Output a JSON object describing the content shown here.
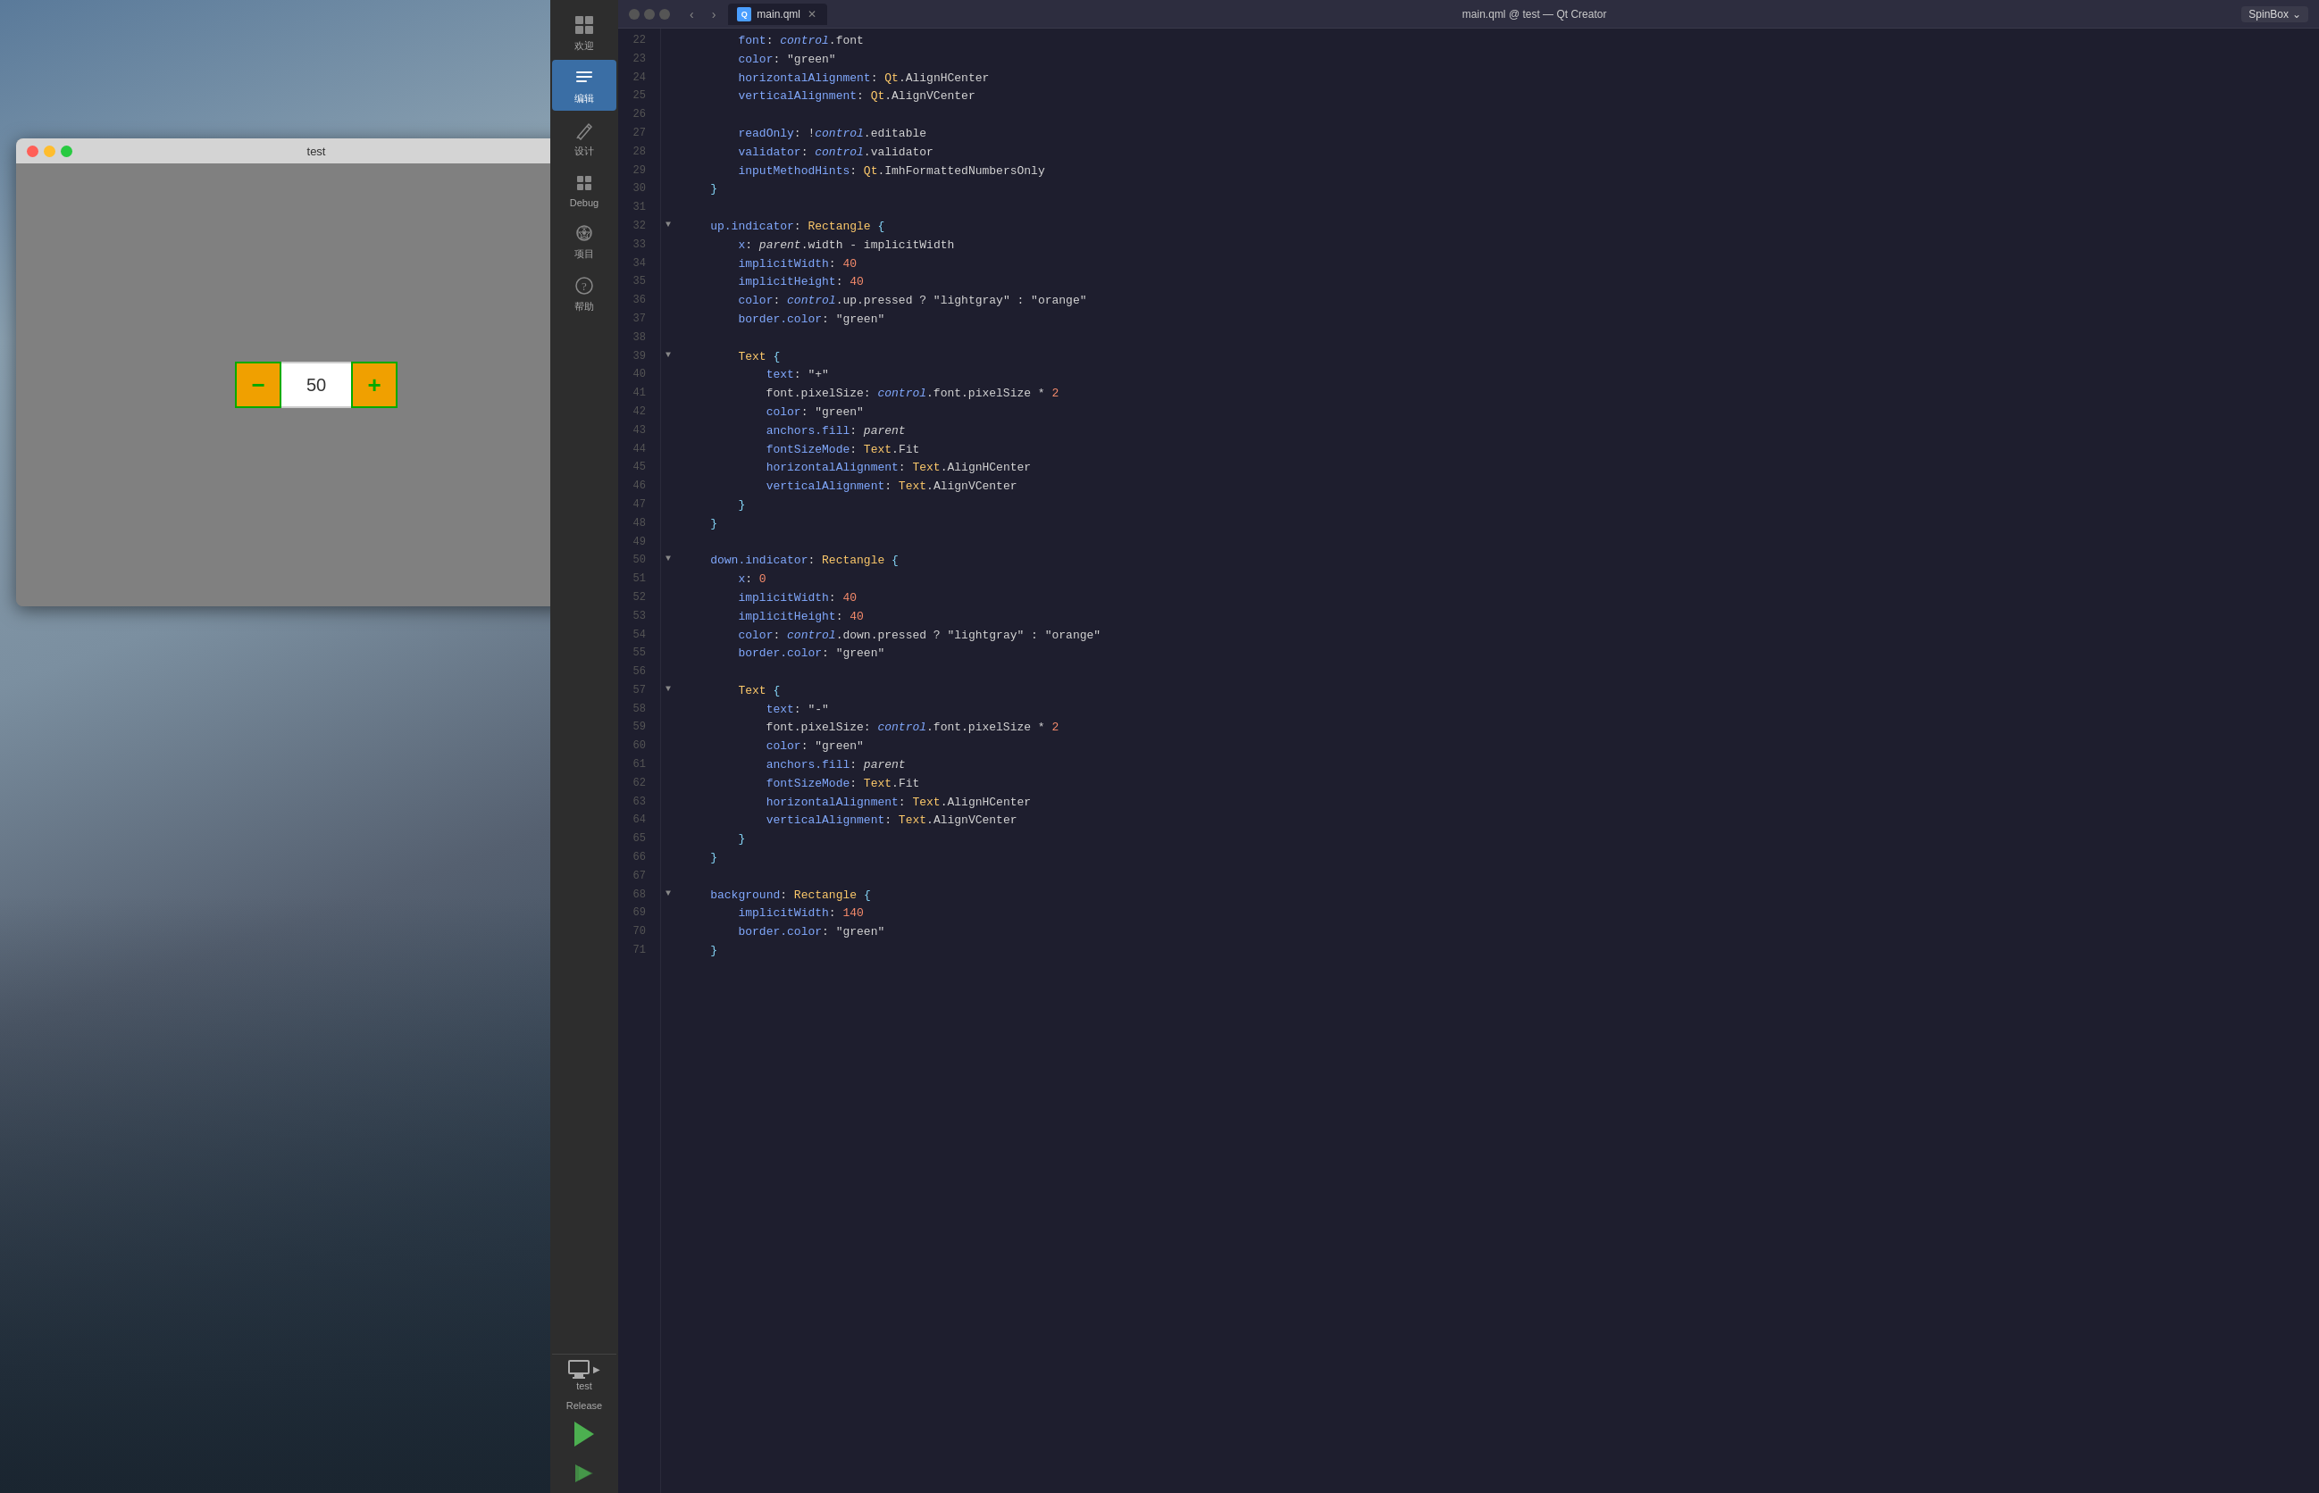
{
  "window": {
    "title": "main.qml @ test — Qt Creator"
  },
  "test_window": {
    "title": "test",
    "spinbox_value": "50"
  },
  "toolbar": {
    "items": [
      {
        "id": "welcome",
        "label": "欢迎",
        "icon": "⊞"
      },
      {
        "id": "edit",
        "label": "编辑",
        "icon": "≡",
        "active": true
      },
      {
        "id": "design",
        "label": "设计",
        "icon": "✏"
      },
      {
        "id": "debug",
        "label": "Debug",
        "icon": "🔲"
      },
      {
        "id": "project",
        "label": "项目",
        "icon": "🔧"
      },
      {
        "id": "help",
        "label": "帮助",
        "icon": "?"
      }
    ],
    "run": {
      "kit_label": "test",
      "build_label": "Release",
      "run_label": "▶",
      "debug_label": "▶"
    }
  },
  "editor": {
    "filename": "main.qml",
    "context": "test",
    "component": "SpinBox",
    "lines": [
      {
        "num": 22,
        "content": "        font: control.font"
      },
      {
        "num": 23,
        "content": "        color: \"green\""
      },
      {
        "num": 24,
        "content": "        horizontalAlignment: Qt.AlignHCenter"
      },
      {
        "num": 25,
        "content": "        verticalAlignment: Qt.AlignVCenter"
      },
      {
        "num": 26,
        "content": ""
      },
      {
        "num": 27,
        "content": "        readOnly: !control.editable"
      },
      {
        "num": 28,
        "content": "        validator: control.validator"
      },
      {
        "num": 29,
        "content": "        inputMethodHints: Qt.ImhFormattedNumbersOnly"
      },
      {
        "num": 30,
        "content": "    }"
      },
      {
        "num": 31,
        "content": ""
      },
      {
        "num": 32,
        "content": "    up.indicator: Rectangle {",
        "fold": true
      },
      {
        "num": 33,
        "content": "        x: parent.width - implicitWidth"
      },
      {
        "num": 34,
        "content": "        implicitWidth: 40"
      },
      {
        "num": 35,
        "content": "        implicitHeight: 40"
      },
      {
        "num": 36,
        "content": "        color: control.up.pressed ? \"lightgray\" : \"orange\""
      },
      {
        "num": 37,
        "content": "        border.color: \"green\""
      },
      {
        "num": 38,
        "content": ""
      },
      {
        "num": 39,
        "content": "        Text {",
        "fold": true
      },
      {
        "num": 40,
        "content": "            text: \"+\""
      },
      {
        "num": 41,
        "content": "            font.pixelSize: control.font.pixelSize * 2"
      },
      {
        "num": 42,
        "content": "            color: \"green\""
      },
      {
        "num": 43,
        "content": "            anchors.fill: parent"
      },
      {
        "num": 44,
        "content": "            fontSizeMode: Text.Fit"
      },
      {
        "num": 45,
        "content": "            horizontalAlignment: Text.AlignHCenter"
      },
      {
        "num": 46,
        "content": "            verticalAlignment: Text.AlignVCenter"
      },
      {
        "num": 47,
        "content": "        }"
      },
      {
        "num": 48,
        "content": "    }"
      },
      {
        "num": 49,
        "content": ""
      },
      {
        "num": 50,
        "content": "    down.indicator: Rectangle {",
        "fold": true
      },
      {
        "num": 51,
        "content": "        x: 0"
      },
      {
        "num": 52,
        "content": "        implicitWidth: 40"
      },
      {
        "num": 53,
        "content": "        implicitHeight: 40"
      },
      {
        "num": 54,
        "content": "        color: control.down.pressed ? \"lightgray\" : \"orange\""
      },
      {
        "num": 55,
        "content": "        border.color: \"green\""
      },
      {
        "num": 56,
        "content": ""
      },
      {
        "num": 57,
        "content": "        Text {",
        "fold": true
      },
      {
        "num": 58,
        "content": "            text: \"-\""
      },
      {
        "num": 59,
        "content": "            font.pixelSize: control.font.pixelSize * 2"
      },
      {
        "num": 60,
        "content": "            color: \"green\""
      },
      {
        "num": 61,
        "content": "            anchors.fill: parent"
      },
      {
        "num": 62,
        "content": "            fontSizeMode: Text.Fit"
      },
      {
        "num": 63,
        "content": "            horizontalAlignment: Text.AlignHCenter"
      },
      {
        "num": 64,
        "content": "            verticalAlignment: Text.AlignVCenter"
      },
      {
        "num": 65,
        "content": "        }"
      },
      {
        "num": 66,
        "content": "    }"
      },
      {
        "num": 67,
        "content": ""
      },
      {
        "num": 68,
        "content": "    background: Rectangle {",
        "fold": true
      },
      {
        "num": 69,
        "content": "        implicitWidth: 140"
      },
      {
        "num": 70,
        "content": "        border.color: \"green\""
      },
      {
        "num": 71,
        "content": "    }"
      }
    ]
  }
}
